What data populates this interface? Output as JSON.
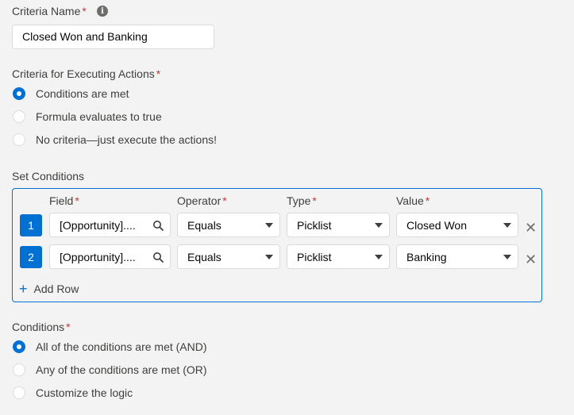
{
  "criteria_name": {
    "label": "Criteria Name",
    "required_mark": "*",
    "info_glyph": "i",
    "value": "Closed Won and Banking"
  },
  "criteria_exec": {
    "label": "Criteria for Executing Actions",
    "required_mark": "*",
    "options": [
      {
        "label": "Conditions are met",
        "selected": true
      },
      {
        "label": "Formula evaluates to true",
        "selected": false
      },
      {
        "label": "No criteria—just execute the actions!",
        "selected": false
      }
    ]
  },
  "set_conditions": {
    "label": "Set Conditions",
    "columns": {
      "field": "Field",
      "operator": "Operator",
      "type": "Type",
      "value": "Value",
      "required_mark": "*"
    },
    "rows": [
      {
        "num": "1",
        "field": "[Opportunity]....",
        "operator": "Equals",
        "type": "Picklist",
        "value": "Closed Won"
      },
      {
        "num": "2",
        "field": "[Opportunity]....",
        "operator": "Equals",
        "type": "Picklist",
        "value": "Banking"
      }
    ],
    "add_row": "Add Row",
    "add_row_glyph": "+",
    "remove_glyph": "✕"
  },
  "conditions": {
    "label": "Conditions",
    "required_mark": "*",
    "options": [
      {
        "label": "All of the conditions are met (AND)",
        "selected": true
      },
      {
        "label": "Any of the conditions are met (OR)",
        "selected": false
      },
      {
        "label": "Customize the logic",
        "selected": false
      }
    ]
  },
  "colors": {
    "brand": "#0070d2",
    "required": "#c23934",
    "border": "#dddbda",
    "background": "#f3f3f3"
  }
}
